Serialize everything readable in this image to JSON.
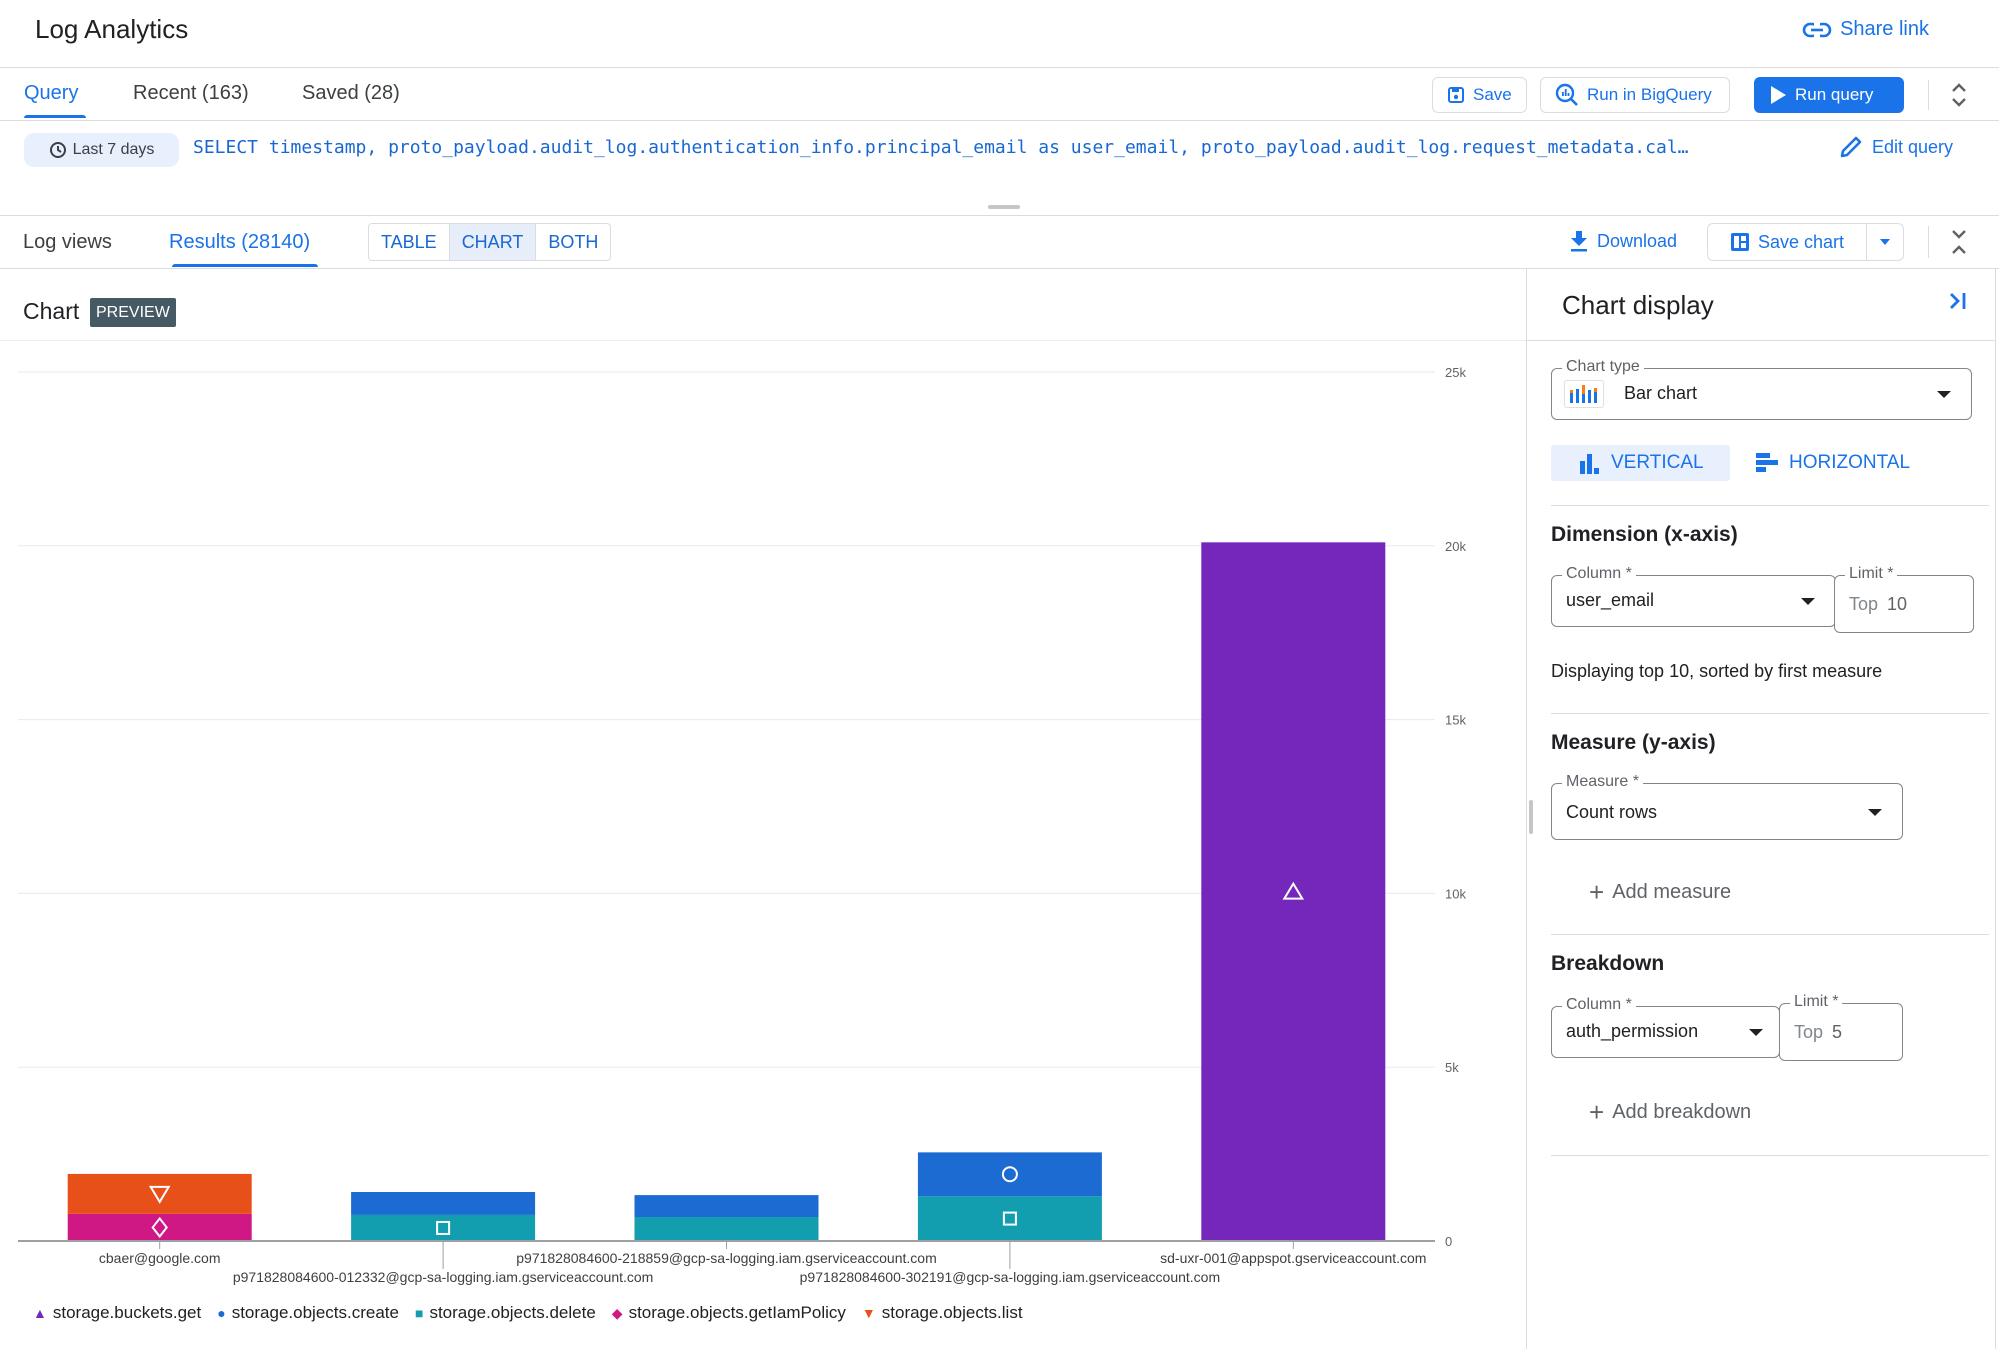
{
  "header": {
    "title": "Log Analytics",
    "share_link": "Share link"
  },
  "query_tabs": [
    {
      "label": "Query",
      "active": true
    },
    {
      "label": "Recent (163)",
      "active": false
    },
    {
      "label": "Saved (28)",
      "active": false
    }
  ],
  "toolbar": {
    "save": "Save",
    "run_in_bigquery": "Run in BigQuery",
    "run_query": "Run query"
  },
  "query": {
    "time_range": "Last 7 days",
    "sql": "SELECT timestamp, proto_payload.audit_log.authentication_info.principal_email as user_email, proto_payload.audit_log.request_metadata.cal…",
    "edit_query": "Edit query"
  },
  "results_bar": {
    "tabs": [
      {
        "label": "Log views",
        "active": false
      },
      {
        "label": "Results (28140)",
        "active": true
      }
    ],
    "view_modes": [
      {
        "label": "TABLE",
        "selected": false
      },
      {
        "label": "CHART",
        "selected": true
      },
      {
        "label": "BOTH",
        "selected": false
      }
    ],
    "download": "Download",
    "save_chart": "Save chart"
  },
  "chart_header": {
    "title": "Chart",
    "badge": "PREVIEW"
  },
  "chart_data": {
    "type": "bar",
    "stacked": true,
    "orientation": "vertical",
    "title": "",
    "xlabel": "",
    "ylabel": "",
    "ylim": [
      0,
      25000
    ],
    "y_ticks": [
      "0",
      "5k",
      "10k",
      "15k",
      "20k",
      "25k"
    ],
    "y_tick_values": [
      0,
      5000,
      10000,
      15000,
      20000,
      25000
    ],
    "y_axis_side": "right",
    "grid": true,
    "legend_position": "bottom-left",
    "categories": [
      "cbaer@google.com",
      "p971828084600-012332@gcp-sa-logging.iam.gserviceaccount.com",
      "p971828084600-218859@gcp-sa-logging.iam.gserviceaccount.com",
      "p971828084600-302191@gcp-sa-logging.iam.gserviceaccount.com",
      "sd-uxr-001@appspot.gserviceaccount.com"
    ],
    "series": [
      {
        "name": "storage.buckets.get",
        "color": "#7627bb",
        "marker": "triangle-up",
        "values": [
          0,
          0,
          0,
          0,
          20100
        ]
      },
      {
        "name": "storage.objects.create",
        "color": "#1c6bd2",
        "marker": "circle",
        "values": [
          0,
          660,
          630,
          1260,
          0
        ]
      },
      {
        "name": "storage.objects.delete",
        "color": "#129eaf",
        "marker": "square",
        "values": [
          0,
          750,
          690,
          1290,
          0
        ]
      },
      {
        "name": "storage.objects.getIamPolicy",
        "color": "#d01884",
        "marker": "diamond",
        "values": [
          780,
          0,
          0,
          0,
          0
        ]
      },
      {
        "name": "storage.objects.list",
        "color": "#e8501a",
        "marker": "triangle-down",
        "values": [
          1150,
          0,
          0,
          0,
          0
        ]
      }
    ],
    "stack_order": [
      "storage.objects.delete",
      "storage.objects.getIamPolicy",
      "storage.objects.create",
      "storage.objects.list",
      "storage.buckets.get"
    ]
  },
  "panel": {
    "title": "Chart display",
    "chart_type_label": "Chart type",
    "chart_type_value": "Bar chart",
    "vertical": "VERTICAL",
    "horizontal": "HORIZONTAL",
    "dimension_title": "Dimension (x-axis)",
    "dim_column_label": "Column *",
    "dim_column_value": "user_email",
    "dim_limit_label": "Limit *",
    "dim_limit_prefix": "Top",
    "dim_limit_value": "10",
    "dim_note": "Displaying top 10, sorted by first measure",
    "measure_title": "Measure (y-axis)",
    "measure_label": "Measure *",
    "measure_value": "Count rows",
    "add_measure": "Add measure",
    "breakdown_title": "Breakdown",
    "bd_column_label": "Column *",
    "bd_column_value": "auth_permission",
    "bd_limit_label": "Limit *",
    "bd_limit_prefix": "Top",
    "bd_limit_value": "5",
    "add_breakdown": "Add breakdown"
  }
}
